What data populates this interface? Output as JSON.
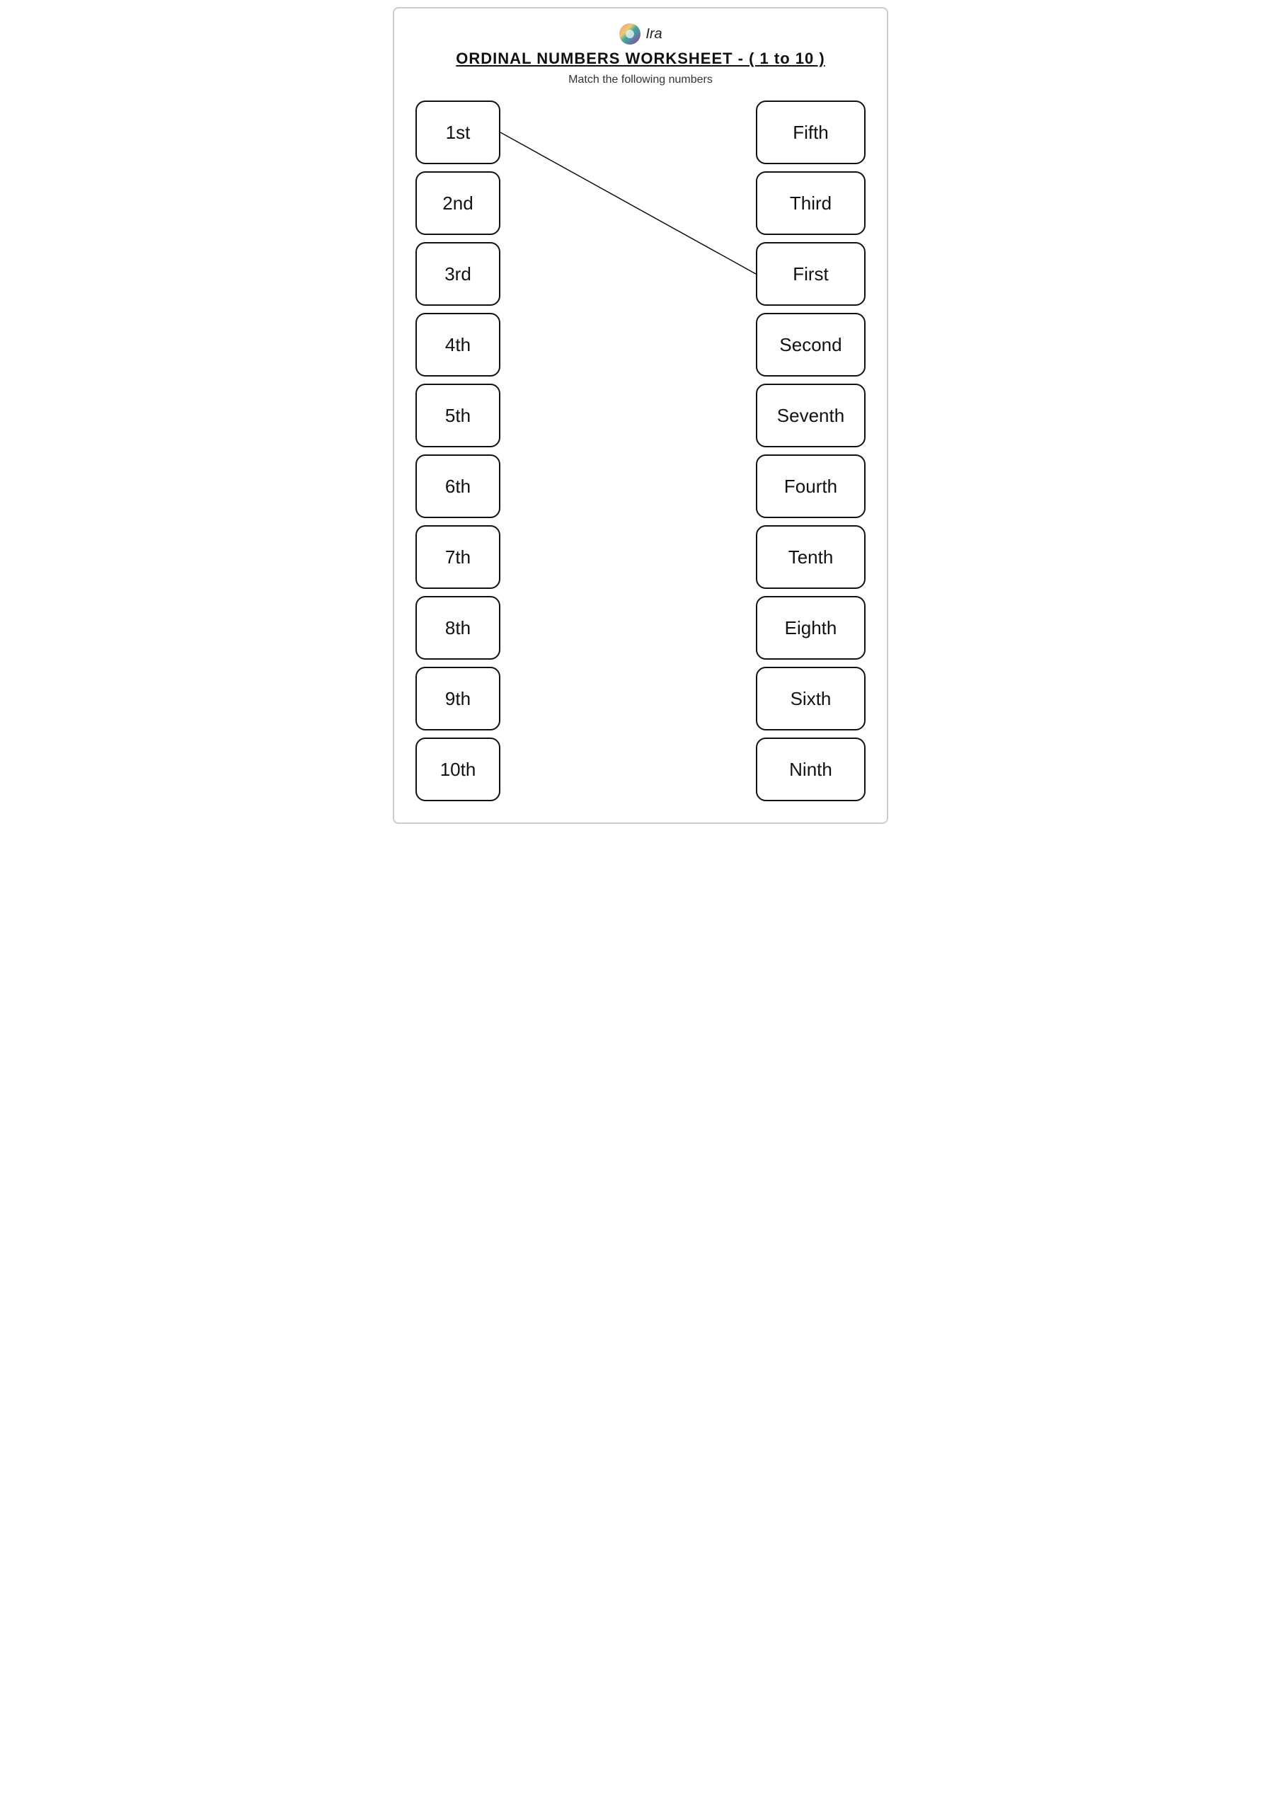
{
  "header": {
    "logo_text": "Ira",
    "title": "ORDINAL NUMBERS WORKSHEET - ( 1 to 10 )",
    "subtitle": "Match the following numbers"
  },
  "left_column": {
    "items": [
      "1st",
      "2nd",
      "3rd",
      "4th",
      "5th",
      "6th",
      "7th",
      "8th",
      "9th",
      "10th"
    ]
  },
  "right_column": {
    "items": [
      "Fifth",
      "Third",
      "First",
      "Second",
      "Seventh",
      "Fourth",
      "Tenth",
      "Eighth",
      "Sixth",
      "Ninth"
    ]
  },
  "line": {
    "description": "1st connects to First (3rd in right column)"
  }
}
